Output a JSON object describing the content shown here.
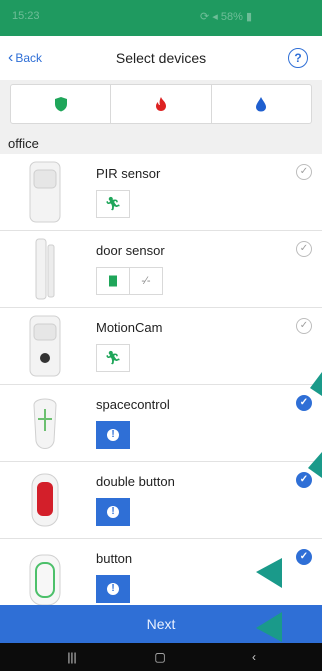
{
  "status": {
    "time": "15:23",
    "right": "⟳ ◂ 58% ▮"
  },
  "header": {
    "back_label": "Back",
    "title": "Select devices",
    "help_label": "?"
  },
  "filters": [
    {
      "icon": "shield-icon",
      "color": "#1fa65a"
    },
    {
      "icon": "fire-icon",
      "color": "#d22"
    },
    {
      "icon": "drop-icon",
      "color": "#1f5fcf"
    }
  ],
  "section": {
    "label": "office"
  },
  "devices": [
    {
      "name": "PIR sensor",
      "selected": false
    },
    {
      "name": "door sensor",
      "selected": false
    },
    {
      "name": "MotionCam",
      "selected": false
    },
    {
      "name": "spacecontrol",
      "selected": true
    },
    {
      "name": "double button",
      "selected": true
    },
    {
      "name": "button",
      "selected": true
    }
  ],
  "footer": {
    "next_label": "Next"
  },
  "colors": {
    "accent": "#2f6fd6",
    "brand_green": "#1f9a60",
    "pointer": "#1a9a8a"
  }
}
